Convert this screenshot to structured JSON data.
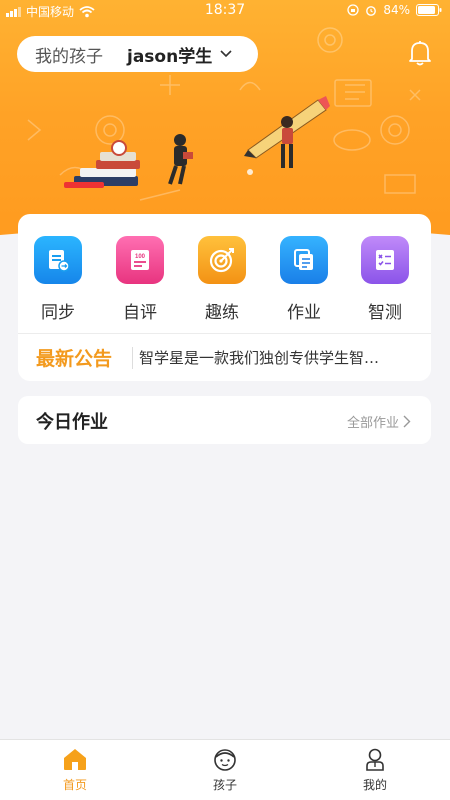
{
  "status_bar": {
    "carrier": "中国移动",
    "time": "18:37",
    "battery": "84%"
  },
  "header": {
    "child_selector_label": "我的孩子",
    "child_name": "jason学生"
  },
  "features": [
    {
      "label": "同步",
      "icon": "sync-book-icon",
      "color": "#1a9ef0"
    },
    {
      "label": "自评",
      "icon": "self-eval-icon",
      "color": "#f0489c"
    },
    {
      "label": "趣练",
      "icon": "target-icon",
      "color": "#f6a11a"
    },
    {
      "label": "作业",
      "icon": "homework-icon",
      "color": "#1f8fef"
    },
    {
      "label": "智测",
      "icon": "smart-test-icon",
      "color": "#a26bf0"
    }
  ],
  "feature_icon_texts": {
    "self_eval_score": "100"
  },
  "notice": {
    "tag": "最新公告",
    "text": "智学星是一款我们独创专供学生智…"
  },
  "today_homework": {
    "title": "今日作业",
    "all_link": "全部作业"
  },
  "tabs": [
    {
      "label": "首页",
      "icon": "home-icon",
      "active": true
    },
    {
      "label": "孩子",
      "icon": "child-icon",
      "active": false
    },
    {
      "label": "我的",
      "icon": "profile-icon",
      "active": false
    }
  ],
  "colors": {
    "accent": "#f39a1e",
    "banner": "#ffa226",
    "background": "#f4f4f7"
  }
}
